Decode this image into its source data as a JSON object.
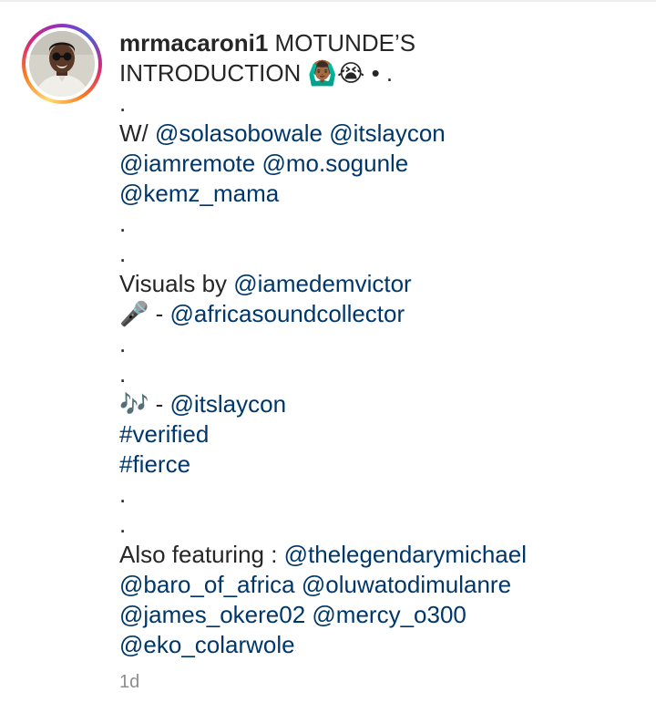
{
  "post": {
    "username": "mrmacaroni1",
    "title": "MOTUNDE’S",
    "title_line2": "INTRODUCTION",
    "emoji_1": "🙆🏾‍♂️",
    "emoji_2": "😭",
    "bullet": "• .",
    "dot": ".",
    "with_prefix": "W/",
    "mentions_with": [
      "@solasobowale",
      "@itslaycon",
      "@iamremote",
      "@mo.sogunle",
      "@kemz_mama"
    ],
    "visuals_prefix": "Visuals by",
    "visuals_mention": "@iamedemvictor",
    "mic_emoji": "🎤",
    "dash": "-",
    "mic_mention": "@africasoundcollector",
    "notes_emoji": "🎶",
    "notes_mention": "@itslaycon",
    "hashtags": [
      "#verified",
      "#fierce"
    ],
    "featuring_prefix": "Also featuring :",
    "mentions_featuring": [
      "@thelegendarymichael",
      "@baro_of_africa",
      "@oluwatodimulanre",
      "@james_okere02",
      "@mercy_o300",
      "@eko_colarwole"
    ],
    "timestamp": "1d"
  },
  "colors": {
    "text": "#262626",
    "link": "#00376b",
    "muted": "#8e8e8e"
  },
  "icons": {
    "avatar": "profile-photo-avatar"
  }
}
